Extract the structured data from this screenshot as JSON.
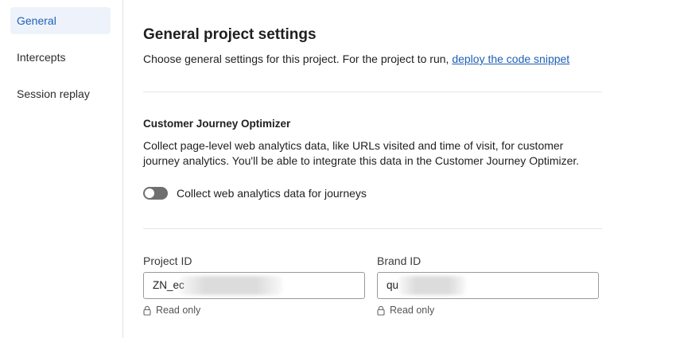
{
  "sidebar": {
    "items": [
      {
        "label": "General",
        "active": true
      },
      {
        "label": "Intercepts",
        "active": false
      },
      {
        "label": "Session replay",
        "active": false
      }
    ]
  },
  "header": {
    "title": "General project settings",
    "description": "Choose general settings for this project. For the project to run, ",
    "link_label": "deploy the code snippet"
  },
  "cjo": {
    "title": "Customer Journey Optimizer",
    "description": "Collect page-level web analytics data, like URLs visited and time of visit, for customer journey analytics. You'll be able to integrate this data in the Customer Journey Optimizer.",
    "toggle_label": "Collect web analytics data for journeys",
    "toggle_on": false
  },
  "fields": {
    "project_id": {
      "label": "Project ID",
      "value": "ZN_ec",
      "note": "Read only"
    },
    "brand_id": {
      "label": "Brand ID",
      "value": "qu",
      "note": "Read only"
    }
  },
  "colors": {
    "accent": "#1f5fb5",
    "active_bg": "#eef3fb",
    "toggle_off": "#6f6f6f"
  },
  "icons": [
    "lock-icon"
  ]
}
